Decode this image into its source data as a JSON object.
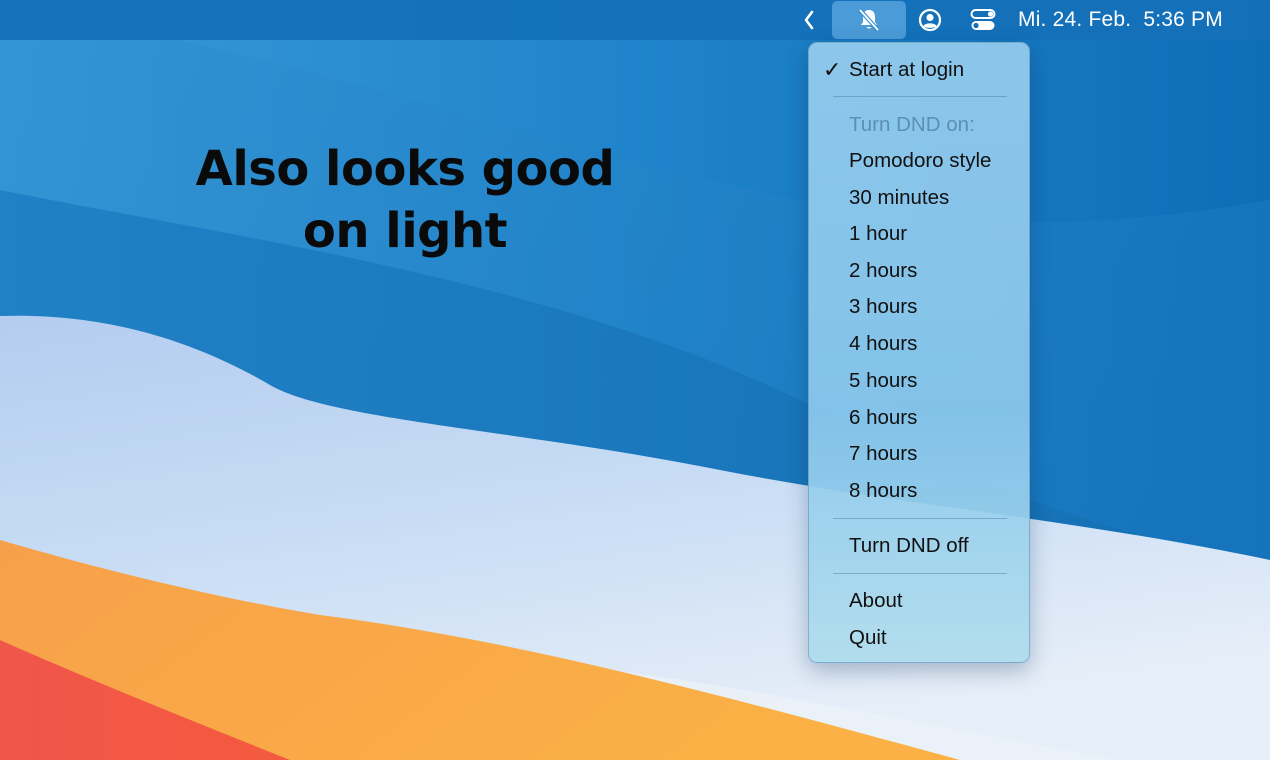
{
  "menubar": {
    "clock": "Mi. 24. Feb.  5:36 PM",
    "icons": [
      "chevron-left-icon",
      "bell-slash-icon",
      "user-circle-icon",
      "control-center-icon"
    ]
  },
  "headline": {
    "line1": "Also looks good",
    "line2": "on light"
  },
  "menu": {
    "start_at_login": "Start at login",
    "start_at_login_checked": true,
    "check_glyph": "✓",
    "section_header": "Turn DND on:",
    "durations": [
      "Pomodoro style",
      "30 minutes",
      "1 hour",
      "2 hours",
      "3 hours",
      "4 hours",
      "5 hours",
      "6 hours",
      "7 hours",
      "8 hours"
    ],
    "turn_off": "Turn DND off",
    "about": "About",
    "quit": "Quit"
  },
  "colors": {
    "sky_blue": "#1a78c2",
    "wave_light": "#bfd6f2",
    "orange": "#f6a23f",
    "red": "#ef4e45"
  }
}
